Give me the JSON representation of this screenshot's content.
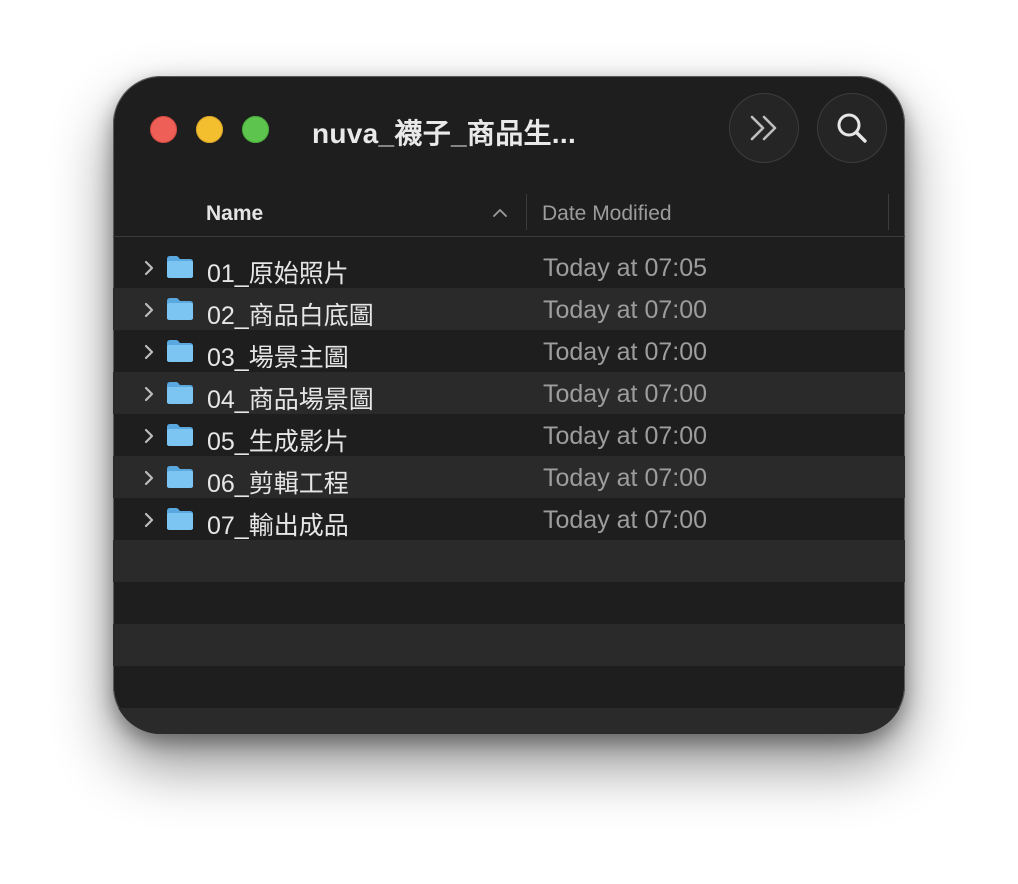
{
  "window": {
    "title": "nuva_襪子_商品生..."
  },
  "toolbar": {
    "more_icon": "chevron-double-right-icon",
    "search_icon": "search-icon"
  },
  "columns": {
    "name": "Name",
    "date_modified": "Date Modified",
    "sort": "ascending"
  },
  "files": [
    {
      "name": "01_原始照片",
      "date": "Today at 07:05",
      "kind": "folder"
    },
    {
      "name": "02_商品白底圖",
      "date": "Today at 07:00",
      "kind": "folder"
    },
    {
      "name": "03_場景主圖",
      "date": "Today at 07:00",
      "kind": "folder"
    },
    {
      "name": "04_商品場景圖",
      "date": "Today at 07:00",
      "kind": "folder"
    },
    {
      "name": "05_生成影片",
      "date": "Today at 07:00",
      "kind": "folder"
    },
    {
      "name": "06_剪輯工程",
      "date": "Today at 07:00",
      "kind": "folder"
    },
    {
      "name": "07_輸出成品",
      "date": "Today at 07:00",
      "kind": "folder"
    }
  ],
  "colors": {
    "window_bg": "#1e1e1e",
    "row_alt_bg": "#2a2a2a",
    "folder": "#6cb8ec",
    "close": "#ee5f57",
    "minimize": "#f4bf2f",
    "maximize": "#5dc54d"
  }
}
